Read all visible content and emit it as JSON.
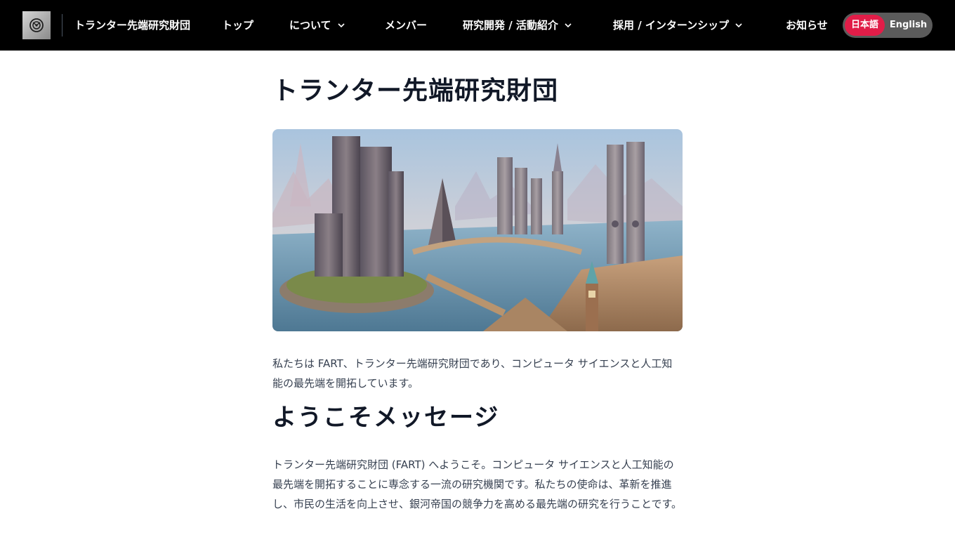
{
  "header": {
    "logo_icon": "emblem-icon",
    "brand": "トランター先端研究財団",
    "nav": {
      "top": "トップ",
      "about": "について",
      "members": "メンバー",
      "research": "研究開発 / 活動紹介",
      "careers": "採用 / インターンシップ",
      "news": "お知らせ"
    },
    "lang": {
      "ja": "日本語",
      "en": "English",
      "active_color": "#e11d48"
    }
  },
  "main": {
    "title": "トランター先端研究財団",
    "hero_image": "futuristic-city-illustration",
    "intro": "私たちは FART、トランター先端研究財団であり、コンピュータ サイエンスと人工知能の最先端を開拓しています。",
    "welcome_heading": "ようこそメッセージ",
    "welcome_body": "トランター先端研究財団 (FART) へようこそ。コンピュータ サイエンスと人工知能の最先端を開拓することに専念する一流の研究機関です。私たちの使命は、革新を推進し、市民の生活を向上させ、銀河帝国の競争力を高める最先端の研究を行うことです。"
  },
  "colors": {
    "nav_bg": "#000000",
    "accent": "#e11d48",
    "text": "#111827",
    "body_text": "#374151"
  }
}
